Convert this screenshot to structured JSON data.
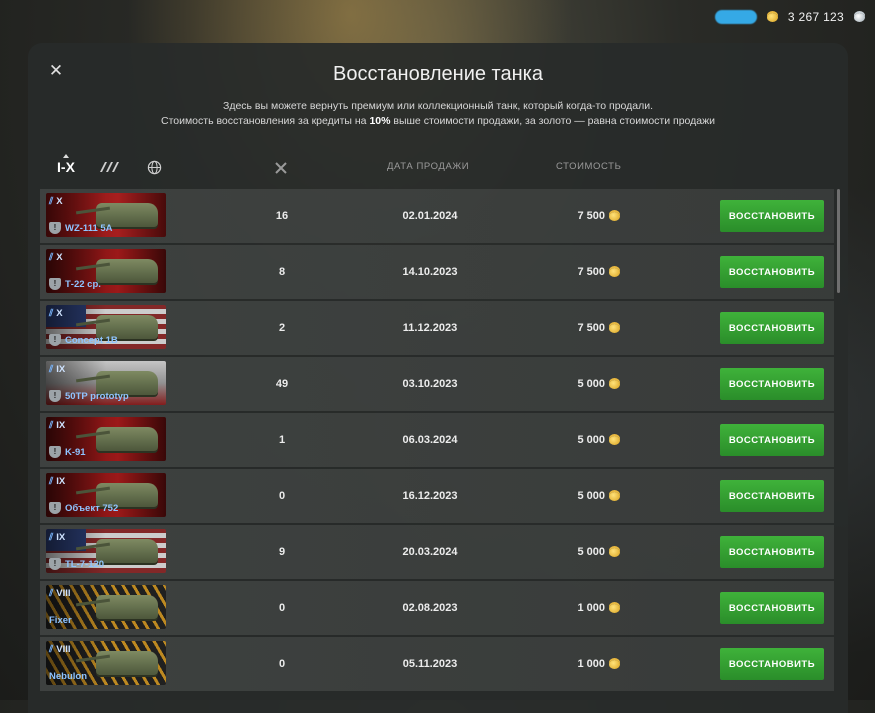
{
  "topbar": {
    "credits": "3 267 123"
  },
  "dialog": {
    "title": "Восстановление танка",
    "subtitle_line1": "Здесь вы можете вернуть премиум или коллекционный танк, который когда-то продали.",
    "subtitle_line2_a": "Стоимость восстановления за кредиты на ",
    "subtitle_line2_b": "10%",
    "subtitle_line2_c": " выше стоимости продажи, за золото — равна стоимости продажи",
    "filters": {
      "tiers": "I-X"
    },
    "columns": {
      "date": "ДАТА ПРОДАЖИ",
      "cost": "СТОИМОСТЬ"
    },
    "restore_label": "ВОССТАНОВИТЬ"
  },
  "tanks": [
    {
      "tier": "X",
      "name": "WZ-111 5A",
      "battles": "16",
      "date": "02.01.2024",
      "cost": "7 500",
      "flag": "cn"
    },
    {
      "tier": "X",
      "name": "Т-22 ср.",
      "battles": "8",
      "date": "14.10.2023",
      "cost": "7 500",
      "flag": "su"
    },
    {
      "tier": "X",
      "name": "Concept 1B",
      "battles": "2",
      "date": "11.12.2023",
      "cost": "7 500",
      "flag": "us"
    },
    {
      "tier": "IX",
      "name": "50TP prototyp",
      "battles": "49",
      "date": "03.10.2023",
      "cost": "5 000",
      "flag": "pl"
    },
    {
      "tier": "IX",
      "name": "K-91",
      "battles": "1",
      "date": "06.03.2024",
      "cost": "5 000",
      "flag": "su"
    },
    {
      "tier": "IX",
      "name": "Объект 752",
      "battles": "0",
      "date": "16.12.2023",
      "cost": "5 000",
      "flag": "su"
    },
    {
      "tier": "IX",
      "name": "TL-7-120",
      "battles": "9",
      "date": "20.03.2024",
      "cost": "5 000",
      "flag": "us"
    },
    {
      "tier": "VIII",
      "name": "Fixer",
      "battles": "0",
      "date": "02.08.2023",
      "cost": "1 000",
      "flag": "mix"
    },
    {
      "tier": "VIII",
      "name": "Nebulon",
      "battles": "0",
      "date": "05.11.2023",
      "cost": "1 000",
      "flag": "mix"
    }
  ]
}
